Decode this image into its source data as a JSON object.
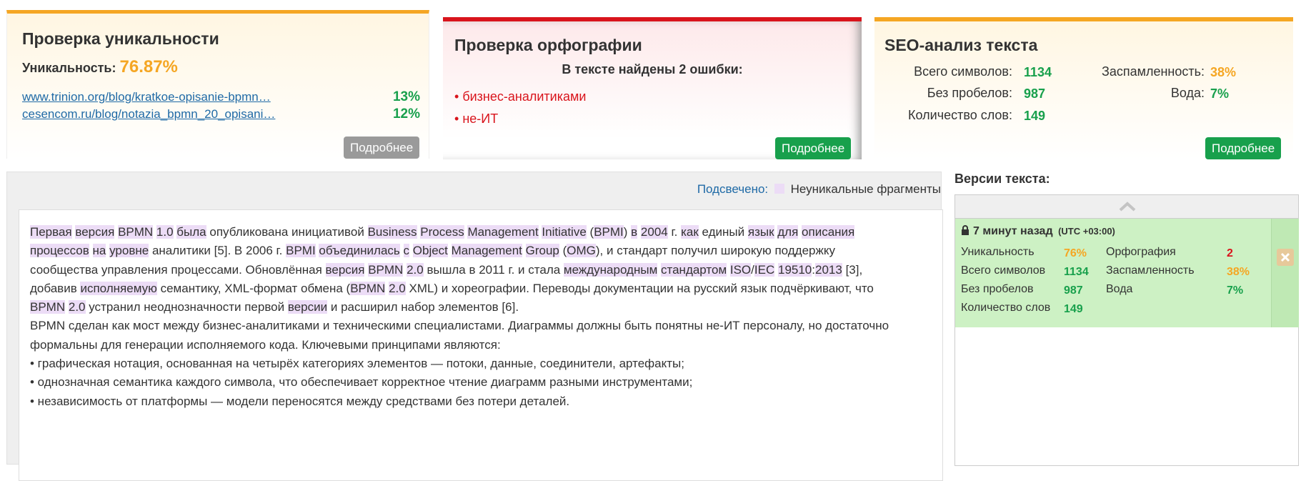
{
  "uniqueness": {
    "title": "Проверка уникальности",
    "label": "Уникальность:",
    "value": "76.87%",
    "sources": [
      {
        "url": "www.trinion.org/blog/kratkoe-opisanie-bpmn…",
        "percent": "13%"
      },
      {
        "url": "cesencom.ru/blog/notazia_bpmn_20_opisani…",
        "percent": "12%"
      }
    ],
    "button": "Подробнее"
  },
  "spelling": {
    "title": "Проверка орфографии",
    "summary": "В тексте найдены 2 ошибки:",
    "errors": [
      "бизнес-аналитиками",
      "не-ИТ"
    ],
    "button": "Подробнее"
  },
  "seo": {
    "title": "SEO-анализ текста",
    "total_chars_label": "Всего символов:",
    "total_chars": "1134",
    "no_spaces_label": "Без пробелов:",
    "no_spaces": "987",
    "words_label": "Количество слов:",
    "words": "149",
    "spam_label": "Заспамленность:",
    "spam": "38%",
    "water_label": "Вода:",
    "water": "7%",
    "button": "Подробнее"
  },
  "editor": {
    "legend_label": "Подсвечено:",
    "legend_text": "Неуникальные фрагменты",
    "highlight_color": "#ecdcf6"
  },
  "versions": {
    "title": "Версии текста:",
    "entry": {
      "time": "7 минут назад",
      "tz": "(UTC +03:00)",
      "uniq_label": "Уникальность",
      "uniq": "76%",
      "spell_label": "Орфография",
      "spell": "2",
      "total_label": "Всего символов",
      "total": "1134",
      "spam_label": "Заспамленность",
      "spam": "38%",
      "nospace_label": "Без пробелов",
      "nospace": "987",
      "water_label": "Вода",
      "water": "7%",
      "words_label": "Количество слов",
      "words": "149"
    }
  },
  "colors": {
    "accent_orange": "#f5a623",
    "accent_red": "#d9141c",
    "accent_green": "#18a04c",
    "version_bg": "#cdf1c4"
  },
  "text": {
    "p1_s1": "Первая",
    "p1_s2": "версия",
    "p1_s3": "BPMN",
    "p1_s4": "1.0",
    "p1_s5": "была",
    "p1_t1": "опубликована инициативой",
    "p1_s6": "Business",
    "p1_s7": "Process",
    "p1_s8": "Management",
    "p1_s9": "Initiative",
    "p1_t2": "(",
    "p1_s10": "BPMI",
    "p1_t3": ")",
    "p1_s11": "в",
    "p1_s12": "2004",
    "p1_t4": "г.",
    "p1_s13": "как",
    "p1_t5": "единый",
    "p1_s14": "язык",
    "p1_s15": "для",
    "p1_s16": "описания",
    "p1_s17": "процессов",
    "p1_s18": "на",
    "p1_s19": "уровне",
    "p1_t6": "аналитики [5]. В 2006 г.",
    "p1_s20": "BPMI",
    "p1_s21": "объединилась",
    "p1_s22": "с",
    "p1_s23": "Object",
    "p1_s24": "Management",
    "p1_s25": "Group",
    "p1_t7": "(",
    "p1_s26": "OMG",
    "p1_t8": "), и стандарт получил широкую поддержку",
    "p1_t9": "сообщества управления процессами. Обновлённая",
    "p1_s27": "версия",
    "p1_s28": "BPMN",
    "p1_s29": "2.0",
    "p1_t10": "вышла в 2011 г. и стала",
    "p1_s30": "международным",
    "p1_s31": "стандартом",
    "p1_s32": "ISO",
    "p1_t11": "/",
    "p1_s33": "IEC",
    "p1_s34": "19510",
    "p1_t12": ":",
    "p1_s35": "2013",
    "p1_t13": "[3],",
    "p1_t14": "добавив",
    "p1_s36": "исполняемую",
    "p1_t15": "семантику, XML-формат обмена (",
    "p1_s37": "BPMN",
    "p1_s38": "2.0",
    "p1_t16": "XML) и хореографии. Переводы документации на русский язык подчёркивают, что",
    "p1_s39": "BPMN",
    "p1_s40": "2.0",
    "p1_t17": "устранил неоднозначности первой",
    "p1_s41": "версии",
    "p1_t18": "и расширил набор элементов [6].",
    "p2": "BPMN сделан как мост между бизнес-аналитиками и техническими специалистами. Диаграммы должны быть понятны не-ИТ персоналу, но достаточно формальны для генерации исполняемого кода. Ключевыми принципами являются:",
    "b1": "• графическая нотация, основанная на четырёх категориях элементов — потоки, данные, соединители, артефакты;",
    "b2": "• однозначная семантика каждого символа, что обеспечивает корректное чтение диаграмм разными инструментами;",
    "b3": "• независимость от платформы — модели переносятся между средствами без потери деталей."
  }
}
